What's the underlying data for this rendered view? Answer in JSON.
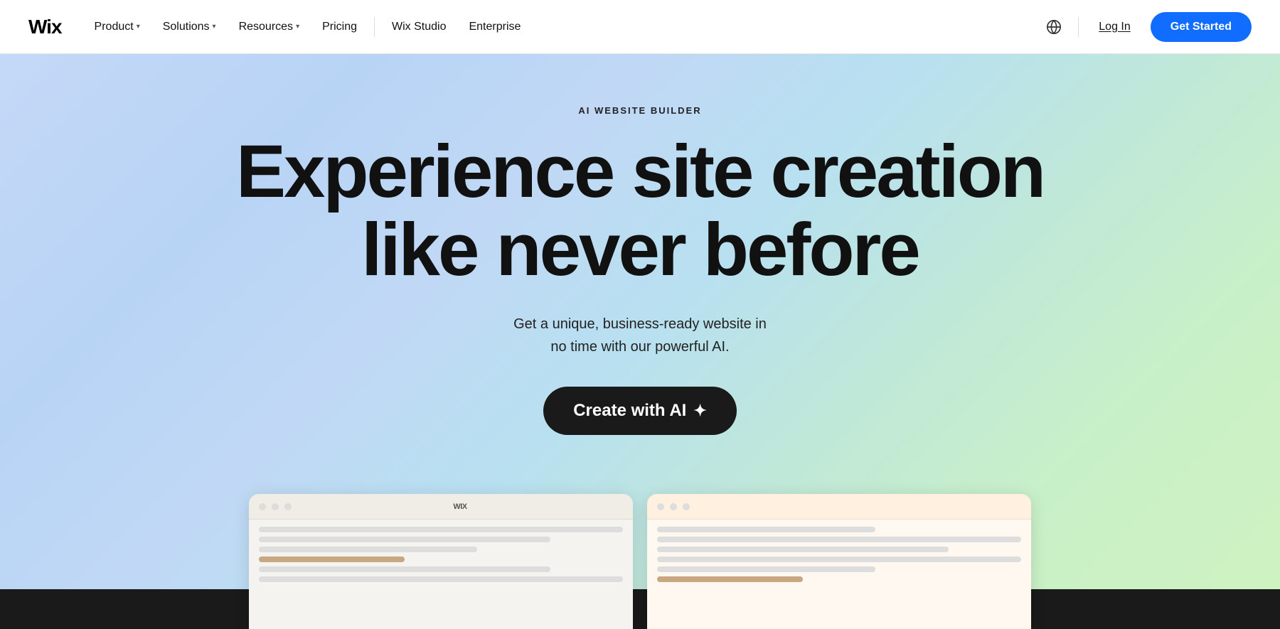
{
  "nav": {
    "logo": "Wix",
    "items": [
      {
        "label": "Product",
        "has_dropdown": true
      },
      {
        "label": "Solutions",
        "has_dropdown": true
      },
      {
        "label": "Resources",
        "has_dropdown": true
      },
      {
        "label": "Pricing",
        "has_dropdown": false
      },
      {
        "label": "Wix Studio",
        "has_dropdown": false
      },
      {
        "label": "Enterprise",
        "has_dropdown": false
      }
    ],
    "login_label": "Log In",
    "get_started_label": "Get Started"
  },
  "hero": {
    "badge": "AI WEBSITE BUILDER",
    "title_line1": "Experience site creation",
    "title_line2": "like never before",
    "subtitle_line1": "Get a unique, business-ready website in",
    "subtitle_line2": "no time with our powerful AI.",
    "cta_label": "Create with AI",
    "sparkle": "✦"
  }
}
